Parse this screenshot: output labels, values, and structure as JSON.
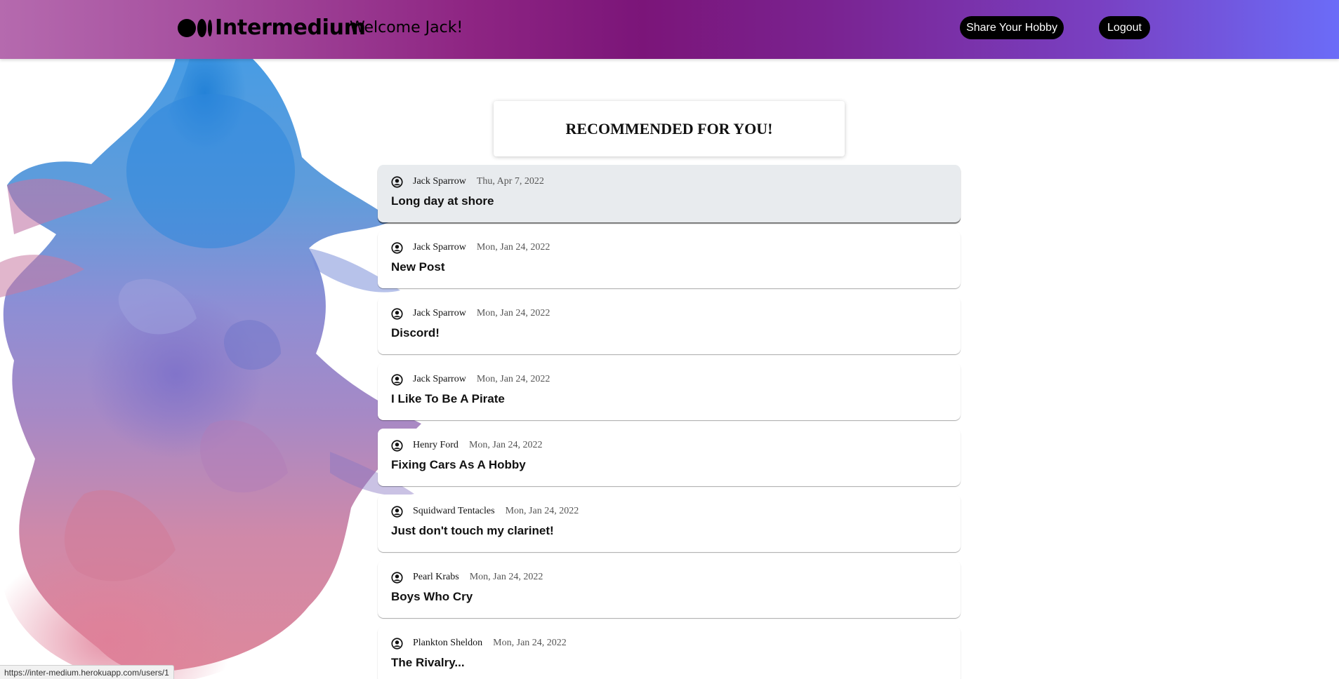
{
  "header": {
    "logo_text": "Intermedium",
    "welcome": "Welcome Jack!",
    "share_label": "Share Your Hobby",
    "logout_label": "Logout"
  },
  "main": {
    "section_title": "RECOMMENDED FOR YOU!",
    "posts": [
      {
        "author": "Jack Sparrow",
        "date": "Thu, Apr 7, 2022",
        "title": "Long day at shore"
      },
      {
        "author": "Jack Sparrow",
        "date": "Mon, Jan 24, 2022",
        "title": "New Post"
      },
      {
        "author": "Jack Sparrow",
        "date": "Mon, Jan 24, 2022",
        "title": "Discord!"
      },
      {
        "author": "Jack Sparrow",
        "date": "Mon, Jan 24, 2022",
        "title": "I Like To Be A Pirate"
      },
      {
        "author": "Henry Ford",
        "date": "Mon, Jan 24, 2022",
        "title": "Fixing Cars As A Hobby"
      },
      {
        "author": "Squidward Tentacles",
        "date": "Mon, Jan 24, 2022",
        "title": "Just don't touch my clarinet!"
      },
      {
        "author": "Pearl Krabs",
        "date": "Mon, Jan 24, 2022",
        "title": "Boys Who Cry"
      },
      {
        "author": "Plankton Sheldon",
        "date": "Mon, Jan 24, 2022",
        "title": "The Rivalry..."
      }
    ]
  },
  "status_bar": {
    "url": "https://inter-medium.herokuapp.com/users/1"
  },
  "colors": {
    "header_gradient_start": "#b56aae",
    "header_gradient_mid": "#7b1579",
    "header_gradient_end": "#6b6cf8",
    "button_bg": "#000000",
    "hovered_post_bg": "#e8ebee"
  },
  "icons": {
    "post_author": "user-circle-icon"
  }
}
